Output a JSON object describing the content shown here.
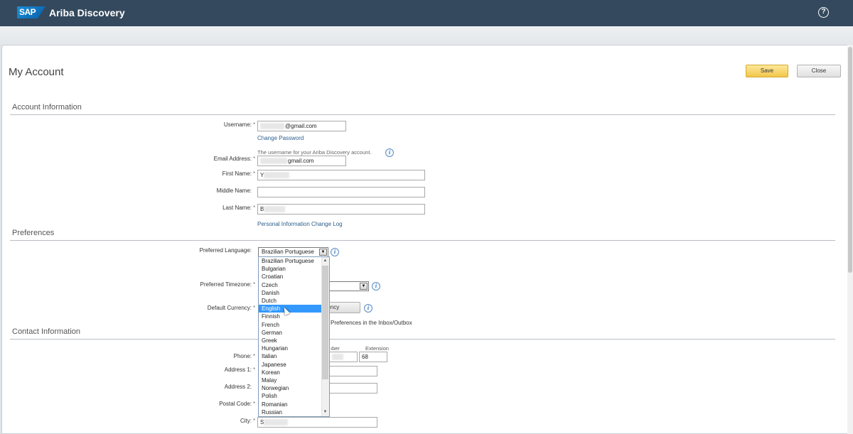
{
  "header": {
    "logo": "SAP",
    "app_name": "Ariba Discovery",
    "help_icon": "question-circle-icon",
    "help_glyph": "?"
  },
  "page": {
    "title": "My Account",
    "save_label": "Save",
    "close_label": "Close"
  },
  "account": {
    "section_title": "Account Information",
    "username_label": "Username:",
    "username_value": "@gmail.com",
    "change_password": "Change Password",
    "username_hint": "The username for your Ariba Discovery account.",
    "email_label": "Email Address:",
    "email_value": "gmail.com",
    "first_name_label": "First Name:",
    "first_name_value": "Y",
    "middle_name_label": "Middle Name:",
    "middle_name_value": "",
    "last_name_label": "Last Name:",
    "last_name_value": "B",
    "change_log": "Personal Information Change Log"
  },
  "preferences": {
    "section_title": "Preferences",
    "language_label": "Preferred Language:",
    "language_value": "Brazilian Portuguese",
    "language_options": [
      "Brazilian Portuguese",
      "Bulgarian",
      "Croatian",
      "Czech",
      "Danish",
      "Dutch",
      "English",
      "Finnish",
      "French",
      "German",
      "Greek",
      "Hungarian",
      "Italian",
      "Japanese",
      "Korean",
      "Malay",
      "Norwegian",
      "Polish",
      "Romanian",
      "Russian"
    ],
    "highlighted_option": "English",
    "timezone_label": "Preferred Timezone:",
    "currency_label": "Default Currency:",
    "currency_button_fragment": "rrency",
    "inbox_text_fragment": "Preferences in the Inbox/Outbox"
  },
  "contact": {
    "section_title": "Contact Information",
    "phone_label": "Phone:",
    "number_label_fragment": "ıber",
    "extension_label": "Extension",
    "extension_value": "68",
    "address1_label": "Address 1:",
    "address2_label": "Address 2:",
    "postal_code_label": "Postal Code:",
    "city_label": "City:",
    "city_value": "S"
  },
  "common": {
    "required_marker": "*",
    "info_glyph": "i",
    "dropdown_arrow": "▼",
    "scroll_up": "▲",
    "scroll_down": "▼"
  },
  "colors": {
    "header_bg": "#34495e",
    "save_button": "#f2c64b",
    "link": "#2a5e8c",
    "selection": "#3399ff"
  }
}
